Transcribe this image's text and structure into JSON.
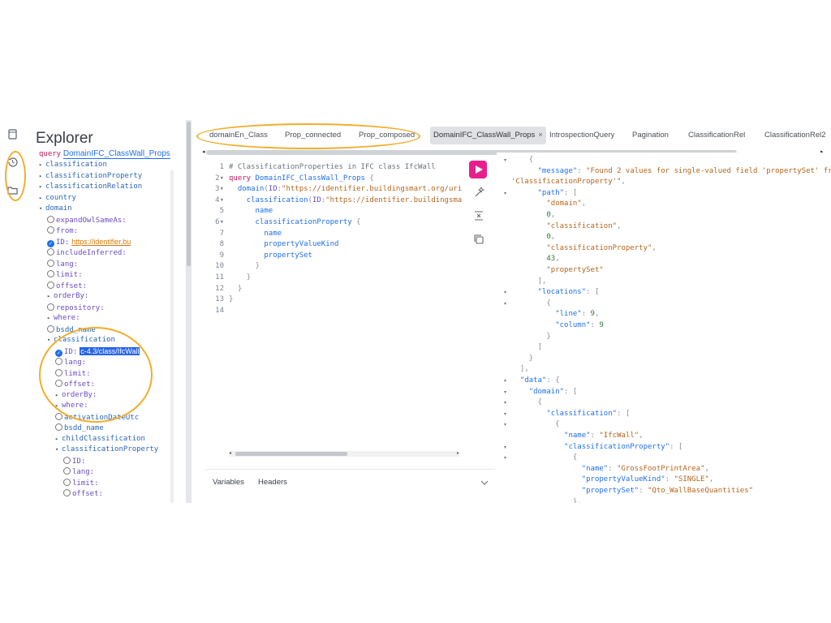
{
  "explorer": {
    "title": "Explorer",
    "query_keyword": "query",
    "query_name": "DomainIFC_ClassWall_Props",
    "rows": [
      {
        "kind": "field",
        "arrow": "▸",
        "label": "classification"
      },
      {
        "kind": "field",
        "arrow": "▸",
        "label": "classificationProperty"
      },
      {
        "kind": "field",
        "arrow": "▸",
        "label": "classificationRelation"
      },
      {
        "kind": "field",
        "arrow": "▸",
        "label": "country"
      },
      {
        "kind": "field",
        "arrow": "▾",
        "label": "domain"
      },
      {
        "kind": "arg",
        "radio": "off",
        "label": "expandOwlSameAs:"
      },
      {
        "kind": "arg",
        "radio": "off",
        "label": "from:"
      },
      {
        "kind": "arg",
        "radio": "on",
        "label": "ID:",
        "value": "https://identifier.bu"
      },
      {
        "kind": "arg",
        "radio": "off",
        "label": "includeInferred:"
      },
      {
        "kind": "arg",
        "radio": "off",
        "label": "lang:"
      },
      {
        "kind": "arg",
        "radio": "off",
        "label": "limit:"
      },
      {
        "kind": "arg",
        "radio": "off",
        "label": "offset:"
      },
      {
        "kind": "arg",
        "arrow": "▸",
        "label": "orderBy:"
      },
      {
        "kind": "arg",
        "radio": "off",
        "label": "repository:"
      },
      {
        "kind": "arg",
        "arrow": "▸",
        "label": "where:"
      },
      {
        "kind": "field",
        "radio": "off",
        "label": "bsdd_name"
      },
      {
        "kind": "field",
        "arrow": "▾",
        "label": "classification"
      },
      {
        "kind": "arg",
        "radio": "on",
        "label": "ID:",
        "selected": "c-4.3/class/IfcWall"
      },
      {
        "kind": "arg",
        "radio": "off",
        "label": "lang:"
      },
      {
        "kind": "arg",
        "radio": "off",
        "label": "limit:"
      },
      {
        "kind": "arg",
        "radio": "off",
        "label": "offset:"
      },
      {
        "kind": "arg",
        "arrow": "▸",
        "label": "orderBy:"
      },
      {
        "kind": "arg",
        "arrow": "▸",
        "label": "where:"
      },
      {
        "kind": "field",
        "radio": "off",
        "label": "activationDateUtc"
      },
      {
        "kind": "field",
        "radio": "off",
        "label": "bsdd_name"
      },
      {
        "kind": "field",
        "arrow": "▸",
        "label": "childClassification"
      },
      {
        "kind": "field",
        "arrow": "▾",
        "label": "classificationProperty"
      },
      {
        "kind": "arg",
        "radio": "off",
        "label": "ID:"
      },
      {
        "kind": "arg",
        "radio": "off",
        "label": "lang:"
      },
      {
        "kind": "arg",
        "radio": "off",
        "label": "limit:"
      },
      {
        "kind": "arg",
        "radio": "off",
        "label": "offset:"
      }
    ]
  },
  "tabs": [
    {
      "label": "domainEn_Class"
    },
    {
      "label": "Prop_connected"
    },
    {
      "label": "Prop_composed"
    },
    {
      "label": "DomainIFC_ClassWall_Props",
      "active": true,
      "close": "×"
    },
    {
      "label": "IntrospectionQuery"
    },
    {
      "label": "Pagination"
    },
    {
      "label": "ClassificationRel"
    },
    {
      "label": "ClassificationRel2"
    }
  ],
  "editor": {
    "lines": [
      {
        "n": "1",
        "fold": "",
        "html": [
          [
            "c-comment",
            "# ClassificationProperties in IFC class IfcWall"
          ]
        ]
      },
      {
        "n": "2",
        "fold": "▾",
        "html": [
          [
            "c-kw",
            "query "
          ],
          [
            "c-fn",
            "DomainIFC_ClassWall_Props "
          ],
          [
            "c-pn",
            "{"
          ]
        ]
      },
      {
        "n": "3",
        "fold": "▾",
        "html": [
          [
            "",
            "  "
          ],
          [
            "c-fld",
            "domain"
          ],
          [
            "c-pn",
            "("
          ],
          [
            "c-arg",
            "ID"
          ],
          [
            "c-pn",
            ":"
          ],
          [
            "c-str",
            "\"https://identifier.buildingsmart.org/uri"
          ]
        ]
      },
      {
        "n": "4",
        "fold": "▾",
        "html": [
          [
            "",
            "    "
          ],
          [
            "c-fld",
            "classification"
          ],
          [
            "c-pn",
            "("
          ],
          [
            "c-arg",
            "ID"
          ],
          [
            "c-pn",
            ":"
          ],
          [
            "c-str",
            "\"https://identifier.buildingsma"
          ]
        ]
      },
      {
        "n": "5",
        "fold": "",
        "html": [
          [
            "",
            "      "
          ],
          [
            "c-fld",
            "name"
          ]
        ]
      },
      {
        "n": "6",
        "fold": "▾",
        "html": [
          [
            "",
            "      "
          ],
          [
            "c-fld",
            "classificationProperty "
          ],
          [
            "c-pn",
            "{"
          ]
        ]
      },
      {
        "n": "7",
        "fold": "",
        "html": [
          [
            "",
            "        "
          ],
          [
            "c-fld",
            "name"
          ]
        ]
      },
      {
        "n": "8",
        "fold": "",
        "html": [
          [
            "",
            "        "
          ],
          [
            "c-fld",
            "propertyValueKind"
          ]
        ]
      },
      {
        "n": "9",
        "fold": "",
        "html": [
          [
            "",
            "        "
          ],
          [
            "c-fld",
            "propertySet"
          ]
        ]
      },
      {
        "n": "10",
        "fold": "",
        "html": [
          [
            "c-pn",
            "      }"
          ]
        ]
      },
      {
        "n": "11",
        "fold": "",
        "html": [
          [
            "c-pn",
            "    }"
          ]
        ]
      },
      {
        "n": "12",
        "fold": "",
        "html": [
          [
            "c-pn",
            "  }"
          ]
        ]
      },
      {
        "n": "13",
        "fold": "",
        "html": [
          [
            "c-pn",
            "}"
          ]
        ]
      },
      {
        "n": "14",
        "fold": "",
        "html": []
      }
    ],
    "variables_label": "Variables",
    "headers_label": "Headers",
    "expand_icon": "chevron-down-icon"
  },
  "result": {
    "lines": [
      {
        "fold": "▾",
        "parts": [
          [
            "r-pn",
            "    {"
          ]
        ]
      },
      {
        "fold": "",
        "parts": [
          [
            "",
            "      "
          ],
          [
            "r-key",
            "\"message\""
          ],
          [
            "r-pn",
            ": "
          ],
          [
            "r-str",
            "\"Found 2 values for single-valued field 'propertySet' fr"
          ]
        ]
      },
      {
        "fold": "",
        "parts": [
          [
            "r-str",
            "'ClassificationProperty'\""
          ],
          [
            "r-pn",
            ","
          ]
        ]
      },
      {
        "fold": "▾",
        "parts": [
          [
            "",
            "      "
          ],
          [
            "r-key",
            "\"path\""
          ],
          [
            "r-pn",
            ": ["
          ]
        ]
      },
      {
        "fold": "",
        "parts": [
          [
            "",
            "        "
          ],
          [
            "r-str",
            "\"domain\""
          ],
          [
            "r-pn",
            ","
          ]
        ]
      },
      {
        "fold": "",
        "parts": [
          [
            "",
            "        "
          ],
          [
            "r-num",
            "0"
          ],
          [
            "r-pn",
            ","
          ]
        ]
      },
      {
        "fold": "",
        "parts": [
          [
            "",
            "        "
          ],
          [
            "r-str",
            "\"classification\""
          ],
          [
            "r-pn",
            ","
          ]
        ]
      },
      {
        "fold": "",
        "parts": [
          [
            "",
            "        "
          ],
          [
            "r-num",
            "0"
          ],
          [
            "r-pn",
            ","
          ]
        ]
      },
      {
        "fold": "",
        "parts": [
          [
            "",
            "        "
          ],
          [
            "r-str",
            "\"classificationProperty\""
          ],
          [
            "r-pn",
            ","
          ]
        ]
      },
      {
        "fold": "",
        "parts": [
          [
            "",
            "        "
          ],
          [
            "r-num",
            "43"
          ],
          [
            "r-pn",
            ","
          ]
        ]
      },
      {
        "fold": "",
        "parts": [
          [
            "",
            "        "
          ],
          [
            "r-str",
            "\"propertySet\""
          ]
        ]
      },
      {
        "fold": "",
        "parts": [
          [
            "r-pn",
            "      ],"
          ]
        ]
      },
      {
        "fold": "▾",
        "parts": [
          [
            "",
            "      "
          ],
          [
            "r-key",
            "\"locations\""
          ],
          [
            "r-pn",
            ": ["
          ]
        ]
      },
      {
        "fold": "▾",
        "parts": [
          [
            "r-pn",
            "        {"
          ]
        ]
      },
      {
        "fold": "",
        "parts": [
          [
            "",
            "          "
          ],
          [
            "r-key",
            "\"line\""
          ],
          [
            "r-pn",
            ": "
          ],
          [
            "r-num",
            "9"
          ],
          [
            "r-pn",
            ","
          ]
        ]
      },
      {
        "fold": "",
        "parts": [
          [
            "",
            "          "
          ],
          [
            "r-key",
            "\"column\""
          ],
          [
            "r-pn",
            ": "
          ],
          [
            "r-num",
            "9"
          ]
        ]
      },
      {
        "fold": "",
        "parts": [
          [
            "r-pn",
            "        }"
          ]
        ]
      },
      {
        "fold": "",
        "parts": [
          [
            "r-pn",
            "      ]"
          ]
        ]
      },
      {
        "fold": "",
        "parts": [
          [
            "r-pn",
            "    }"
          ]
        ]
      },
      {
        "fold": "",
        "parts": [
          [
            "r-pn",
            "  ],"
          ]
        ]
      },
      {
        "fold": "▾",
        "parts": [
          [
            "",
            "  "
          ],
          [
            "r-key",
            "\"data\""
          ],
          [
            "r-pn",
            ": {"
          ]
        ]
      },
      {
        "fold": "▾",
        "parts": [
          [
            "",
            "    "
          ],
          [
            "r-key",
            "\"domain\""
          ],
          [
            "r-pn",
            ": ["
          ]
        ]
      },
      {
        "fold": "▾",
        "parts": [
          [
            "r-pn",
            "      {"
          ]
        ]
      },
      {
        "fold": "▾",
        "parts": [
          [
            "",
            "        "
          ],
          [
            "r-key",
            "\"classification\""
          ],
          [
            "r-pn",
            ": ["
          ]
        ]
      },
      {
        "fold": "▾",
        "parts": [
          [
            "r-pn",
            "          {"
          ]
        ]
      },
      {
        "fold": "",
        "parts": [
          [
            "",
            "            "
          ],
          [
            "r-key",
            "\"name\""
          ],
          [
            "r-pn",
            ": "
          ],
          [
            "r-str",
            "\"IfcWall\""
          ],
          [
            "r-pn",
            ","
          ]
        ]
      },
      {
        "fold": "▾",
        "parts": [
          [
            "",
            "            "
          ],
          [
            "r-key",
            "\"classificationProperty\""
          ],
          [
            "r-pn",
            ": ["
          ]
        ]
      },
      {
        "fold": "▾",
        "parts": [
          [
            "r-pn",
            "              {"
          ]
        ]
      },
      {
        "fold": "",
        "parts": [
          [
            "",
            "                "
          ],
          [
            "r-key",
            "\"name\""
          ],
          [
            "r-pn",
            ": "
          ],
          [
            "r-str",
            "\"GrossFootPrintArea\""
          ],
          [
            "r-pn",
            ","
          ]
        ]
      },
      {
        "fold": "",
        "parts": [
          [
            "",
            "                "
          ],
          [
            "r-key",
            "\"propertyValueKind\""
          ],
          [
            "r-pn",
            ": "
          ],
          [
            "r-str",
            "\"SINGLE\""
          ],
          [
            "r-pn",
            ","
          ]
        ]
      },
      {
        "fold": "",
        "parts": [
          [
            "",
            "                "
          ],
          [
            "r-key",
            "\"propertySet\""
          ],
          [
            "r-pn",
            ": "
          ],
          [
            "r-str",
            "\"Qto_WallBaseQuantities\""
          ]
        ]
      },
      {
        "fold": "",
        "parts": [
          [
            "r-pn",
            "              },"
          ]
        ]
      }
    ]
  },
  "icons": {
    "rail": [
      "document-icon",
      "history-icon",
      "folder-icon"
    ],
    "editor_tools": [
      "prettify-icon",
      "merge-icon",
      "copy-icon"
    ]
  },
  "colors": {
    "annotation": "#f2ad2a",
    "run_button": "#e91e8c",
    "field": "#2b66b5",
    "argument": "#6b4cc0"
  }
}
